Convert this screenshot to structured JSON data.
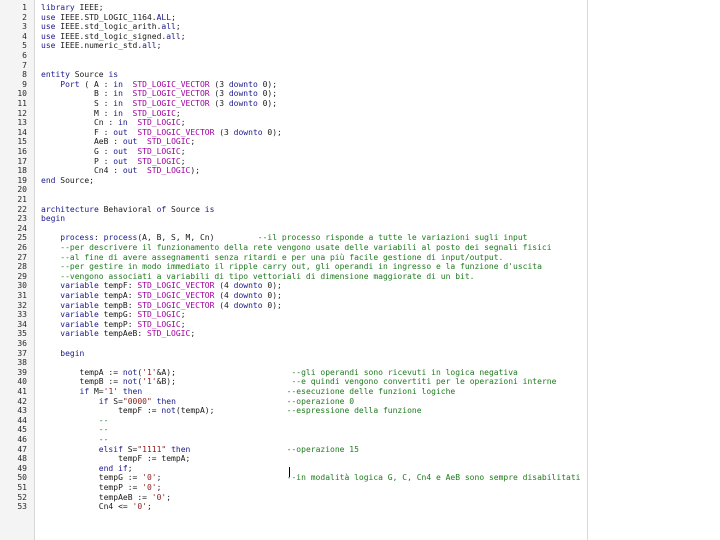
{
  "editor": {
    "lines": [
      {
        "n": "1",
        "t": "library IEEE;"
      },
      {
        "n": "2",
        "t": "use IEEE.STD_LOGIC_1164.ALL;"
      },
      {
        "n": "3",
        "t": "use IEEE.std_logic_arith.all;"
      },
      {
        "n": "4",
        "t": "use IEEE.std_logic_signed.all;"
      },
      {
        "n": "5",
        "t": "use IEEE.numeric_std.all;"
      },
      {
        "n": "6",
        "t": ""
      },
      {
        "n": "7",
        "t": ""
      },
      {
        "n": "8",
        "t": "entity Source is"
      },
      {
        "n": "9",
        "t": "    Port ( A : in  STD_LOGIC_VECTOR (3 downto 0);"
      },
      {
        "n": "10",
        "t": "           B : in  STD_LOGIC_VECTOR (3 downto 0);"
      },
      {
        "n": "11",
        "t": "           S : in  STD_LOGIC_VECTOR (3 downto 0);"
      },
      {
        "n": "12",
        "t": "           M : in  STD_LOGIC;"
      },
      {
        "n": "13",
        "t": "           Cn : in  STD_LOGIC;"
      },
      {
        "n": "14",
        "t": "           F : out  STD_LOGIC_VECTOR (3 downto 0);"
      },
      {
        "n": "15",
        "t": "           AeB : out  STD_LOGIC;"
      },
      {
        "n": "16",
        "t": "           G : out  STD_LOGIC;"
      },
      {
        "n": "17",
        "t": "           P : out  STD_LOGIC;"
      },
      {
        "n": "18",
        "t": "           Cn4 : out  STD_LOGIC);"
      },
      {
        "n": "19",
        "t": "end Source;"
      },
      {
        "n": "20",
        "t": ""
      },
      {
        "n": "21",
        "t": ""
      },
      {
        "n": "22",
        "t": "architecture Behavioral of Source is"
      },
      {
        "n": "23",
        "t": "begin"
      },
      {
        "n": "24",
        "t": ""
      },
      {
        "n": "25",
        "t": "    process: process(A, B, S, M, Cn)         --il processo risponde a tutte le variazioni sugli input"
      },
      {
        "n": "26",
        "t": "    --per descrivere il funzionamento della rete vengono usate delle variabili al posto dei segnali fisici"
      },
      {
        "n": "27",
        "t": "    --al fine di avere assegnamenti senza ritardi e per una più facile gestione di input/output."
      },
      {
        "n": "28",
        "t": "    --per gestire in modo immediato il ripple carry out, gli operandi in ingresso e la funzione d'uscita"
      },
      {
        "n": "29",
        "t": "    --vengono associati a variabili di tipo vettoriali di dimensione maggiorate di un bit."
      },
      {
        "n": "30",
        "t": "    variable tempF: STD_LOGIC_VECTOR (4 downto 0);"
      },
      {
        "n": "31",
        "t": "    variable tempA: STD_LOGIC_VECTOR (4 downto 0);"
      },
      {
        "n": "32",
        "t": "    variable tempB: STD_LOGIC_VECTOR (4 downto 0);"
      },
      {
        "n": "33",
        "t": "    variable tempG: STD_LOGIC;"
      },
      {
        "n": "34",
        "t": "    variable tempP: STD_LOGIC;"
      },
      {
        "n": "35",
        "t": "    variable tempAeB: STD_LOGIC;"
      },
      {
        "n": "36",
        "t": ""
      },
      {
        "n": "37",
        "t": "    begin"
      },
      {
        "n": "38",
        "t": ""
      },
      {
        "n": "39",
        "t": "        tempA := not('1'&A);                        --gli operandi sono ricevuti in logica negativa"
      },
      {
        "n": "40",
        "t": "        tempB := not('1'&B);                        --e quindi vengono convertiti per le operazioni interne"
      },
      {
        "n": "41",
        "t": "        if M='1' then                              --esecuzione delle funzioni logiche"
      },
      {
        "n": "42",
        "t": "            if S=\"0000\" then                       --operazione 0"
      },
      {
        "n": "43",
        "t": "                tempF := not(tempA);               --espressione della funzione"
      },
      {
        "n": "44",
        "t": "            --"
      },
      {
        "n": "45",
        "t": "            --"
      },
      {
        "n": "46",
        "t": "            --"
      },
      {
        "n": "47",
        "t": "            elsif S=\"1111\" then                    --operazione 15"
      },
      {
        "n": "48",
        "t": "                tempF := tempA;"
      },
      {
        "n": "49",
        "t": "            end if;"
      },
      {
        "n": "50",
        "t": "            tempG := '0';                          --in modalità logica G, C, Cn4 e AeB sono sempre disabilitati"
      },
      {
        "n": "51",
        "t": "            tempP := '0';"
      },
      {
        "n": "52",
        "t": "            tempAeB := '0';"
      },
      {
        "n": "53",
        "t": "            Cn4 <= '0';"
      }
    ]
  }
}
